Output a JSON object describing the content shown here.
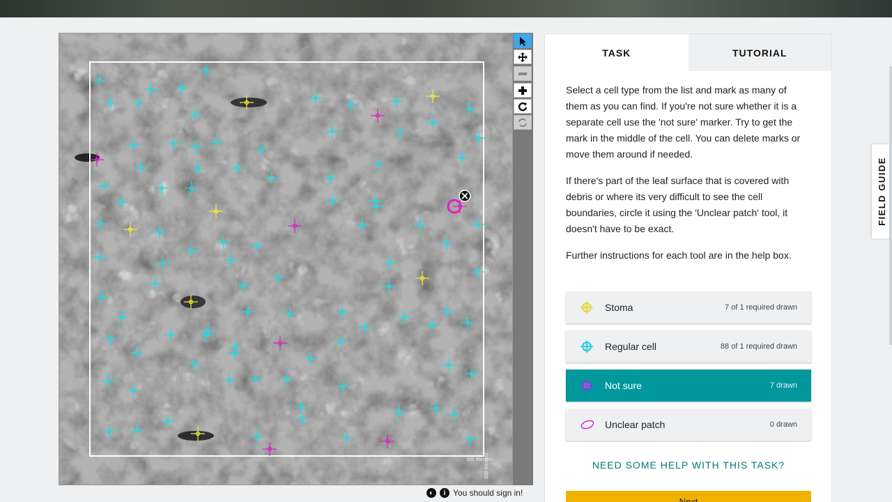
{
  "task_panel": {
    "tabs": [
      {
        "label": "TASK",
        "active": true
      },
      {
        "label": "TUTORIAL",
        "active": false
      }
    ],
    "instructions": [
      "Select a cell type from the list and mark as many of them as you can find. If you're not sure whether it is a separate cell use the 'not sure' marker. Try to get the mark in the middle of the cell. You can delete marks or move them around if needed.",
      "If there's part of the leaf surface that is covered with debris or where its very difficult to see the cell boundaries, circle it using the 'Unclear patch' tool, it doesn't have to be exact.",
      "Further instructions for each tool are in the help box."
    ],
    "tools": [
      {
        "label": "Stoma",
        "count": "7 of 1 required drawn",
        "color": "#f2ee3a",
        "icon": "crosshair-icon",
        "selected": false
      },
      {
        "label": "Regular cell",
        "count": "88 of 1 required drawn",
        "color": "#26d8e6",
        "icon": "crosshair-icon",
        "selected": false
      },
      {
        "label": "Not sure",
        "count": "7 drawn",
        "color": "#8a3fd9",
        "icon": "crosshair-icon",
        "selected": true
      },
      {
        "label": "Unclear patch",
        "count": "0 drawn",
        "color": "#e020c8",
        "icon": "ellipse-icon",
        "selected": false
      }
    ],
    "help_link": "NEED SOME HELP WITH THIS TASK?",
    "next_button": "Next"
  },
  "field_guide": {
    "label": "FIELD GUIDE"
  },
  "viewer": {
    "scale_label": "300 microns",
    "toolbar": [
      {
        "name": "pointer-tool",
        "icon": "cursor-icon",
        "state": "active"
      },
      {
        "name": "move-tool",
        "icon": "move-icon",
        "state": "normal"
      },
      {
        "name": "zoom-out-tool",
        "icon": "minus-icon",
        "state": "disabled"
      },
      {
        "name": "zoom-in-tool",
        "icon": "plus-icon",
        "state": "normal"
      },
      {
        "name": "rotate-tool",
        "icon": "rotate-icon",
        "state": "normal"
      },
      {
        "name": "reset-tool",
        "icon": "reset-icon",
        "state": "disabled"
      }
    ]
  },
  "footer": {
    "signin_text": "You should sign in!"
  },
  "colors": {
    "accent": "#00979d",
    "next_button": "#f0b200",
    "stoma_mark": "#f2ee3a",
    "regular_mark": "#26d8e6",
    "not_sure_mark": "#e020c8"
  }
}
